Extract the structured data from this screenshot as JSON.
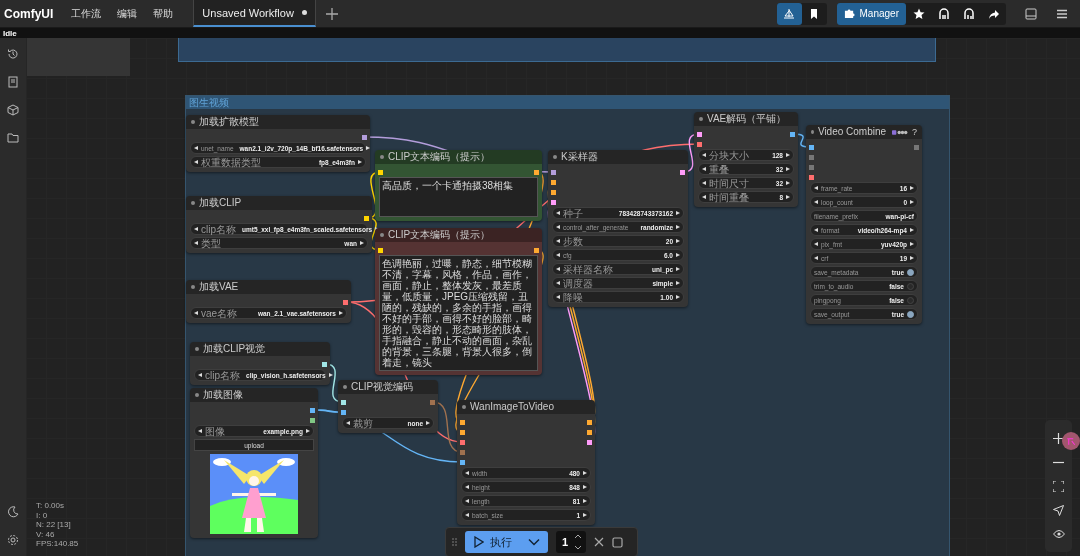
{
  "topbar": {
    "logo": "ComfyUI",
    "menus": [
      "工作流",
      "编辑",
      "帮助"
    ],
    "tabs": [
      {
        "label": "Unsaved Workflow",
        "selected": true,
        "modified": true
      }
    ],
    "manager": "Manager"
  },
  "status": "Idle",
  "group": {
    "title": "图生视频"
  },
  "nodes": [
    {
      "title": "加载扩散模型",
      "outputs": [
        {
          "color": "#b39ddb"
        }
      ],
      "widgets": [
        {
          "kind": "combo",
          "label": "unet_name",
          "value": "wan2.1_i2v_720p_14B_bf16.safetensors"
        },
        {
          "kind": "combo",
          "label": "权重数据类型",
          "value": "fp8_e4m3fn"
        }
      ]
    },
    {
      "title": "加载CLIP",
      "outputs": [
        {
          "color": "#ffd500"
        }
      ],
      "widgets": [
        {
          "kind": "combo",
          "label": "clip名称",
          "value": "umt5_xxl_fp8_e4m3fn_scaled.safetensors"
        },
        {
          "kind": "combo",
          "label": "类型",
          "value": "wan"
        }
      ]
    },
    {
      "title": "加载VAE",
      "outputs": [
        {
          "color": "#ff6e6e"
        }
      ],
      "widgets": [
        {
          "kind": "combo",
          "label": "vae名称",
          "value": "wan_2.1_vae.safetensors"
        }
      ]
    },
    {
      "title": "加载CLIP视觉",
      "outputs": [
        {
          "color": "#a1e6e6"
        }
      ],
      "widgets": [
        {
          "kind": "combo",
          "label": "clip名称",
          "value": "clip_vision_h.safetensors"
        }
      ]
    },
    {
      "title": "加载图像",
      "outputs": [
        {
          "color": "#64b5f6"
        },
        {
          "color": "#81c784"
        }
      ],
      "widgets": [
        {
          "kind": "combo",
          "label": "图像",
          "value": "example.png"
        }
      ],
      "upload": "upload",
      "image": {
        "kind": "picture"
      }
    },
    {
      "title": "CLIP视觉编码",
      "inputs": [
        {
          "color": "#a1e6e6"
        },
        {
          "color": "#64b5f6"
        }
      ],
      "outputs": [
        {
          "color": "#a0714f"
        }
      ],
      "widgets": [
        {
          "kind": "combo",
          "label": "裁剪",
          "value": "none"
        }
      ]
    },
    {
      "title": "CLIP文本编码（提示）",
      "color": "#335533",
      "inputs": [
        {
          "color": "#ffd500"
        }
      ],
      "outputs": [
        {
          "color": "#ffa931"
        }
      ],
      "prompt": "高品质，一个卡通拍摄38相集"
    },
    {
      "title": "CLIP文本编码（提示）",
      "color": "#553333",
      "inputs": [
        {
          "color": "#ffd500"
        }
      ],
      "outputs": [
        {
          "color": "#ffa931"
        }
      ],
      "prompt": "色调艳丽，过曝，静态，细节模糊不清，字幕，风格，作品，画作，画面，静止，整体发灰，最差质量，低质量，JPEG压缩残留，丑陋的，残缺的，多余的手指，画得不好的手部，画得不好的脸部，畸形的，毁容的，形态畸形的肢体，手指融合，静止不动的画面，杂乱的背景，三条腿，背景人很多，倒着走，镜头"
    },
    {
      "title": "WanImageToVideo",
      "inputs": [
        {
          "color": "#ffa931"
        },
        {
          "color": "#ffa931"
        },
        {
          "color": "#ff6e6e"
        },
        {
          "color": "#a0714f"
        },
        {
          "color": "#64b5f6"
        }
      ],
      "outputs": [
        {
          "color": "#ffa931"
        },
        {
          "color": "#ffa931"
        },
        {
          "color": "#ff9cf9"
        }
      ],
      "widgets": [
        {
          "kind": "number",
          "label": "width",
          "value": "480"
        },
        {
          "kind": "number",
          "label": "height",
          "value": "848"
        },
        {
          "kind": "number",
          "label": "length",
          "value": "81"
        },
        {
          "kind": "number",
          "label": "batch_size",
          "value": "1"
        }
      ]
    },
    {
      "title": "K采样器",
      "inputs": [
        {
          "color": "#b39ddb"
        },
        {
          "color": "#ffa931"
        },
        {
          "color": "#ffa931"
        },
        {
          "color": "#ff9cf9"
        }
      ],
      "outputs": [
        {
          "color": "#ff9cf9"
        }
      ],
      "widgets": [
        {
          "kind": "number",
          "label": "种子",
          "value": "783428743373162"
        },
        {
          "kind": "combo",
          "label": "control_after_generate",
          "value": "randomize"
        },
        {
          "kind": "number",
          "label": "步数",
          "value": "20"
        },
        {
          "kind": "number",
          "label": "cfg",
          "value": "6.0"
        },
        {
          "kind": "combo",
          "label": "采样器名称",
          "value": "uni_pc"
        },
        {
          "kind": "combo",
          "label": "调度器",
          "value": "simple"
        },
        {
          "kind": "number",
          "label": "降噪",
          "value": "1.00"
        }
      ]
    },
    {
      "title": "VAE解码（平铺）",
      "inputs": [
        {
          "color": "#ff9cf9"
        },
        {
          "color": "#ff6e6e"
        }
      ],
      "outputs": [
        {
          "color": "#64b5f6"
        }
      ],
      "widgets": [
        {
          "kind": "number",
          "label": "分块大小",
          "value": "128"
        },
        {
          "kind": "number",
          "label": "重叠",
          "value": "32"
        },
        {
          "kind": "number",
          "label": "时间尺寸",
          "value": "32"
        },
        {
          "kind": "number",
          "label": "时间重叠",
          "value": "8"
        }
      ]
    },
    {
      "title": "Video Combine",
      "badge": true,
      "help": "?",
      "inputs": [
        {
          "color": "#64b5f6"
        },
        {
          "color": "#777777"
        },
        {
          "color": "#777777"
        },
        {
          "color": "#ff6e6e"
        }
      ],
      "outputs": [
        {
          "color": "#777777"
        }
      ],
      "widgets": [
        {
          "kind": "number",
          "label": "frame_rate",
          "value": "16"
        },
        {
          "kind": "number",
          "label": "loop_count",
          "value": "0"
        },
        {
          "kind": "text",
          "label": "filename_prefix",
          "value": "wan-pi-cf"
        },
        {
          "kind": "combo",
          "label": "format",
          "value": "video/h264-mp4"
        },
        {
          "kind": "combo",
          "label": "pix_fmt",
          "value": "yuv420p"
        },
        {
          "kind": "number",
          "label": "crf",
          "value": "19"
        },
        {
          "kind": "toggle",
          "label": "save_metadata",
          "value": "true",
          "on": true
        },
        {
          "kind": "toggle",
          "label": "trim_to_audio",
          "value": "false",
          "on": false
        },
        {
          "kind": "toggle",
          "label": "pingpong",
          "value": "false",
          "on": false
        },
        {
          "kind": "toggle",
          "label": "save_output",
          "value": "true",
          "on": true
        }
      ]
    }
  ],
  "stats": [
    "T: 0.00s",
    "I: 0",
    "N: 22 [13]",
    "V: 46",
    "FPS:140.85"
  ],
  "run_bar": {
    "run_label": "执行",
    "count": "1"
  }
}
